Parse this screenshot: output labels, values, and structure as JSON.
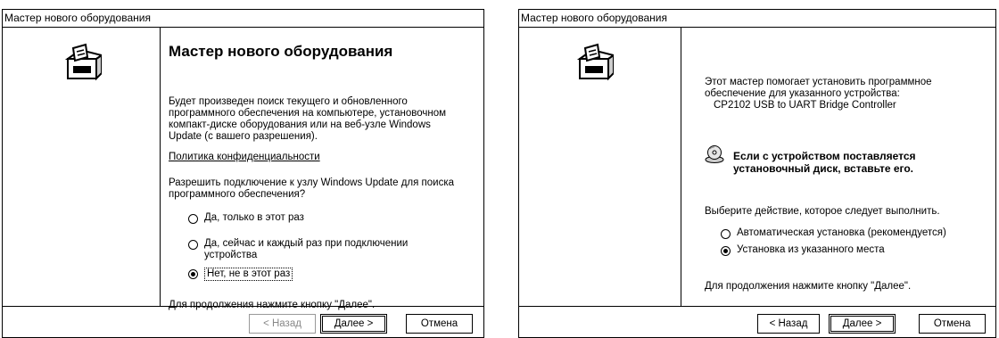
{
  "left": {
    "title": "Мастер нового оборудования",
    "heading": "Мастер нового оборудования",
    "intro": [
      "Будет произведен поиск текущего и обновленного",
      "программного обеспечения на компьютере, установочном",
      "компакт-диске оборудования или на веб-узле Windows",
      "Update (с вашего разрешения)."
    ],
    "privacy_link": "Политика конфиденциальности",
    "question": [
      "Разрешить подключение к узлу Windows Update для поиска",
      "программного обеспечения?"
    ],
    "options": [
      {
        "lines": [
          "Да, только в этот раз"
        ],
        "selected": false
      },
      {
        "lines": [
          "Да, сейчас и каждый раз при подключении",
          "устройства"
        ],
        "selected": false
      },
      {
        "lines": [
          "Нет, не в этот раз"
        ],
        "selected": true
      }
    ],
    "continue_text": "Для продолжения нажмите кнопку \"Далее\".",
    "buttons": {
      "back": "< Назад",
      "next": "Далее >",
      "cancel": "Отмена"
    }
  },
  "right": {
    "title": "Мастер нового оборудования",
    "intro": [
      "Этот мастер помогает установить программное",
      "обеспечение для указанного устройства:"
    ],
    "device": "CP2102 USB to UART Bridge Controller",
    "cd_prompt": [
      "Если с устройством поставляется",
      "установочный диск, вставьте его."
    ],
    "action_prompt": "Выберите действие, которое следует выполнить.",
    "options": [
      {
        "label": "Автоматическая установка (рекомендуется)",
        "selected": false
      },
      {
        "label": "Установка из указанного места",
        "selected": true
      }
    ],
    "continue_text": "Для продолжения нажмите кнопку \"Далее\".",
    "buttons": {
      "back": "< Назад",
      "next": "Далее >",
      "cancel": "Отмена"
    }
  }
}
